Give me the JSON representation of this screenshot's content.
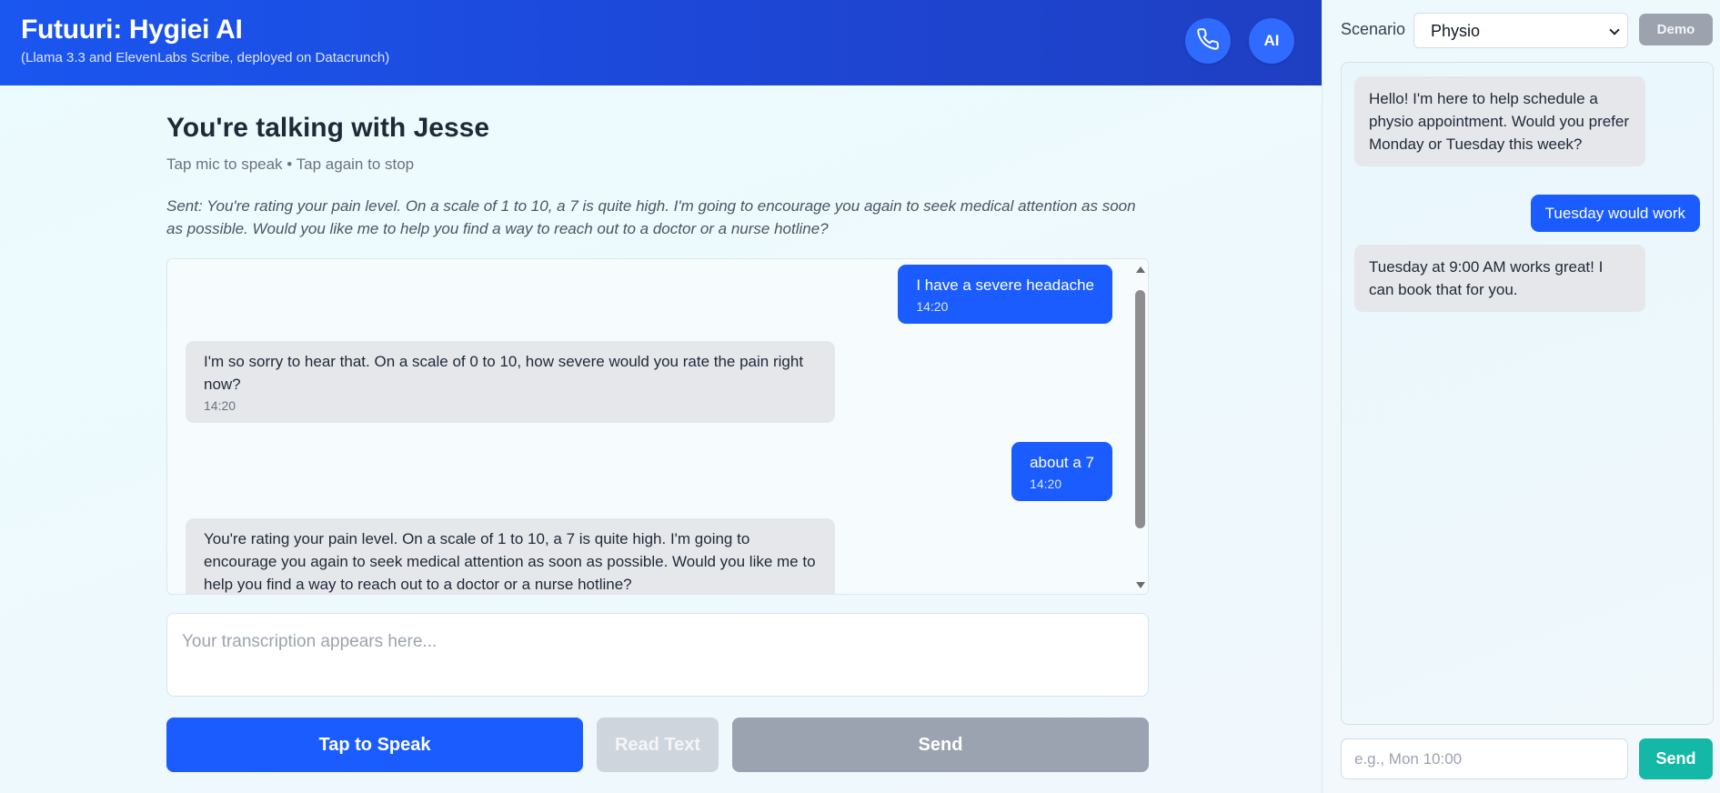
{
  "header": {
    "title": "Futuuri: Hygiei AI",
    "subtitle": "(Llama 3.3 and ElevenLabs Scribe, deployed on Datacrunch)",
    "phone_icon": "phone-icon",
    "ai_label": "AI"
  },
  "talk": {
    "title": "You're talking with Jesse",
    "hint": "Tap mic to speak • Tap again to stop",
    "sent": "Sent: You're rating your pain level. On a scale of 1 to 10, a 7 is quite high. I'm going to encourage you again to seek medical attention as soon as possible. Would you like me to help you find a way to reach out to a doctor or a nurse hotline?"
  },
  "messages": [
    {
      "role": "user",
      "text": "I have a severe headache",
      "time": "14:20"
    },
    {
      "role": "bot",
      "text": "I'm so sorry to hear that. On a scale of 0 to 10, how severe would you rate the pain right now?",
      "time": "14:20"
    },
    {
      "role": "user",
      "text": "about a 7",
      "time": "14:20"
    },
    {
      "role": "bot",
      "text": "You're rating your pain level. On a scale of 1 to 10, a 7 is quite high. I'm going to encourage you again to seek medical attention as soon as possible. Would you like me to help you find a way to reach out to a doctor or a nurse hotline?",
      "time": ""
    }
  ],
  "transcription": {
    "placeholder": "Your transcription appears here..."
  },
  "buttons": {
    "speak": "Tap to Speak",
    "read": "Read Text",
    "send": "Send"
  },
  "panel": {
    "scenario_label": "Scenario",
    "scenario_value": "Physio",
    "demo_label": "Demo",
    "messages": [
      {
        "role": "bot",
        "text": "Hello! I'm here to help schedule a physio appointment. Would you prefer Monday or Tuesday this week?"
      },
      {
        "role": "user",
        "text": "Tuesday would work"
      },
      {
        "role": "bot",
        "text": "Tuesday at 9:00 AM works great! I can book that for you."
      }
    ],
    "input_placeholder": "e.g., Mon 10:00",
    "send_label": "Send"
  },
  "colors": {
    "accent": "#1a5cff",
    "teal": "#14b8a6",
    "bubble_bot": "#e5e7eb",
    "disabled": "#9aa3af"
  }
}
